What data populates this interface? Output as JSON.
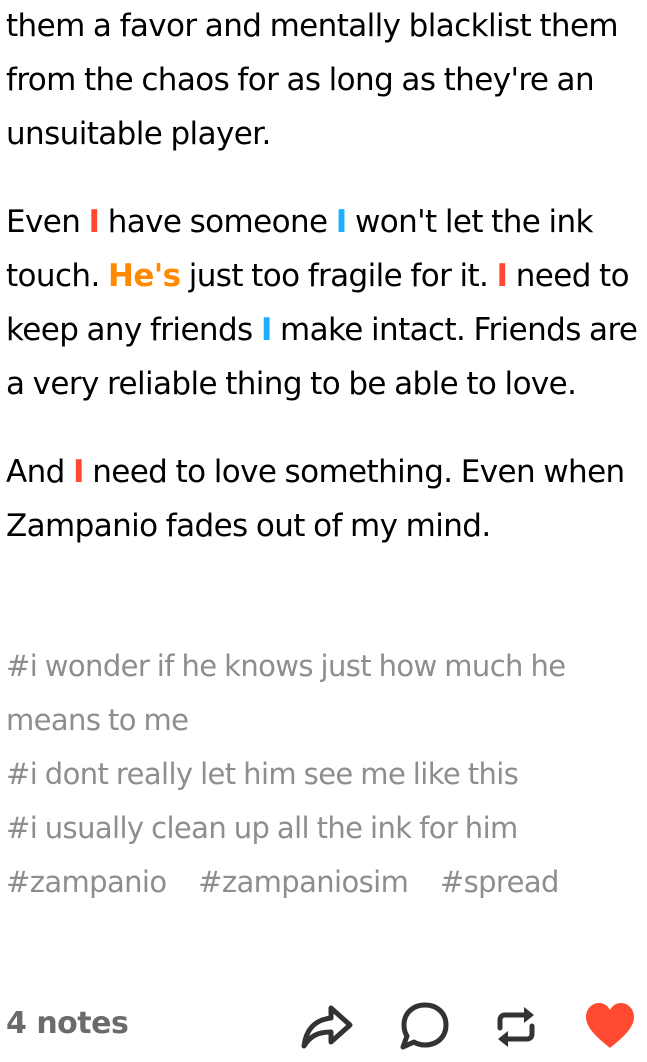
{
  "post": {
    "paragraphs": [
      {
        "segments": [
          {
            "text": "them a favor and mentally blacklist them from the chaos for as long as they're an unsuitable player.",
            "style": "plain"
          }
        ]
      },
      {
        "segments": [
          {
            "text": "Even ",
            "style": "plain"
          },
          {
            "text": "I",
            "style": "red"
          },
          {
            "text": " have someone ",
            "style": "plain"
          },
          {
            "text": "I",
            "style": "blue"
          },
          {
            "text": " won't let the ink touch. ",
            "style": "plain"
          },
          {
            "text": "He's",
            "style": "orange"
          },
          {
            "text": " just too fragile for it. ",
            "style": "plain"
          },
          {
            "text": "I",
            "style": "red"
          },
          {
            "text": " need to keep any friends ",
            "style": "plain"
          },
          {
            "text": "I",
            "style": "blue"
          },
          {
            "text": " make intact. Friends are a very reliable thing to be able to love.",
            "style": "plain"
          }
        ]
      },
      {
        "segments": [
          {
            "text": "And ",
            "style": "plain"
          },
          {
            "text": "I",
            "style": "red"
          },
          {
            "text": " need to love something. Even when Zampanio fades out of my mind.",
            "style": "plain"
          }
        ]
      }
    ],
    "colors": {
      "red": "#ff4930",
      "blue": "#1eaeff",
      "orange": "#ff8a00",
      "tag_gray": "#8e8e8e",
      "like_red": "#ff4930"
    }
  },
  "tags": {
    "line_tags": [
      "#i wonder if he knows just how much he means to me",
      "#i dont really let him see me like this",
      "#i usually clean up all the ink for him"
    ],
    "row_tags": [
      "#zampanio",
      "#zampaniosim",
      "#spread"
    ]
  },
  "footer": {
    "notes_label": "4 notes",
    "icons": [
      "share-icon",
      "reply-icon",
      "reblog-icon",
      "like-icon"
    ],
    "liked": true
  }
}
